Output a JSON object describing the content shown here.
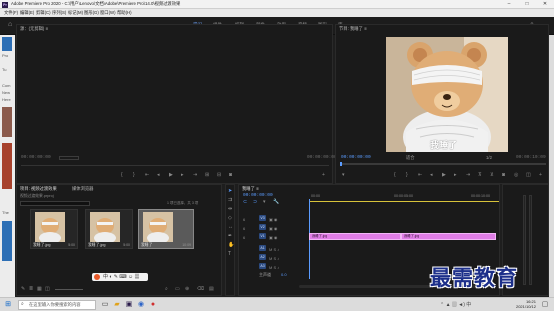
{
  "window": {
    "app_icon": "Pr",
    "title": "Adobe Premiere Pro 2020 - C:\\用户\\Lenovo\\文档\\Adobe\\Premiere Pro\\14.0\\视频过渡效果",
    "controls": [
      "–",
      "□",
      "✕"
    ]
  },
  "menu": [
    "文件(F)",
    "编辑(E)",
    "剪辑(C)",
    "序列(S)",
    "标记(M)",
    "图形(G)",
    "窗口(W)",
    "帮助(H)"
  ],
  "workspaces": [
    {
      "label": "学习",
      "active": true
    },
    {
      "label": "组件",
      "active": false
    },
    {
      "label": "编辑",
      "active": false
    },
    {
      "label": "颜色",
      "active": false
    },
    {
      "label": "效果",
      "active": false
    },
    {
      "label": "音频",
      "active": false
    },
    {
      "label": "图形",
      "active": false
    },
    {
      "label": "库",
      "active": false
    }
  ],
  "left_desktop": {
    "items": [
      "Pro",
      "Tu",
      "Com",
      "New",
      "Here",
      "The"
    ]
  },
  "source_monitor": {
    "header": "源：(无剪辑) ≡",
    "timecode_left": "00:00:00:00",
    "timecode_right": "00:00:00:00"
  },
  "program_monitor": {
    "header": "节目: 我睡了 ≡",
    "caption": "我睡了",
    "timecode_left": "00:00:00:00",
    "fit": "适合",
    "fraction": "1/2",
    "timecode_right": "00:00:10:09"
  },
  "project": {
    "tabs": [
      "项目: 视频过渡效果",
      "媒体浏览器"
    ],
    "filename": "视频过渡效果.prproj",
    "item_count": "1 项已选择，共 3 项",
    "items": [
      {
        "label": "我睡了.jpg",
        "duration": "5:00",
        "selected": false
      },
      {
        "label": "我睡了.jpg",
        "duration": "5:00",
        "selected": false
      },
      {
        "label": "我睡了",
        "duration": "10:09",
        "selected": true
      }
    ]
  },
  "timeline": {
    "header": "我睡了 ≡",
    "timecode": "00:00:00:00",
    "ruler": [
      "00:00",
      "00:00:05:00",
      "00:00:10:00"
    ],
    "tracks": [
      "V3",
      "V2",
      "V1",
      "A1",
      "A2",
      "A3"
    ],
    "master": "主声道",
    "master_value": "0.0",
    "clips": [
      {
        "label": "我睡了.jpg"
      },
      {
        "label": "我睡了.jpg"
      }
    ]
  },
  "watermark": "最需教育",
  "taskbar": {
    "search_placeholder": "在这里输入你要搜索的内容",
    "time": "16:21",
    "date": "2021/10/12"
  },
  "colors": {
    "accent": "#5b9cff",
    "clip": "#e07de6",
    "panel_bg": "#1a1a1a"
  }
}
